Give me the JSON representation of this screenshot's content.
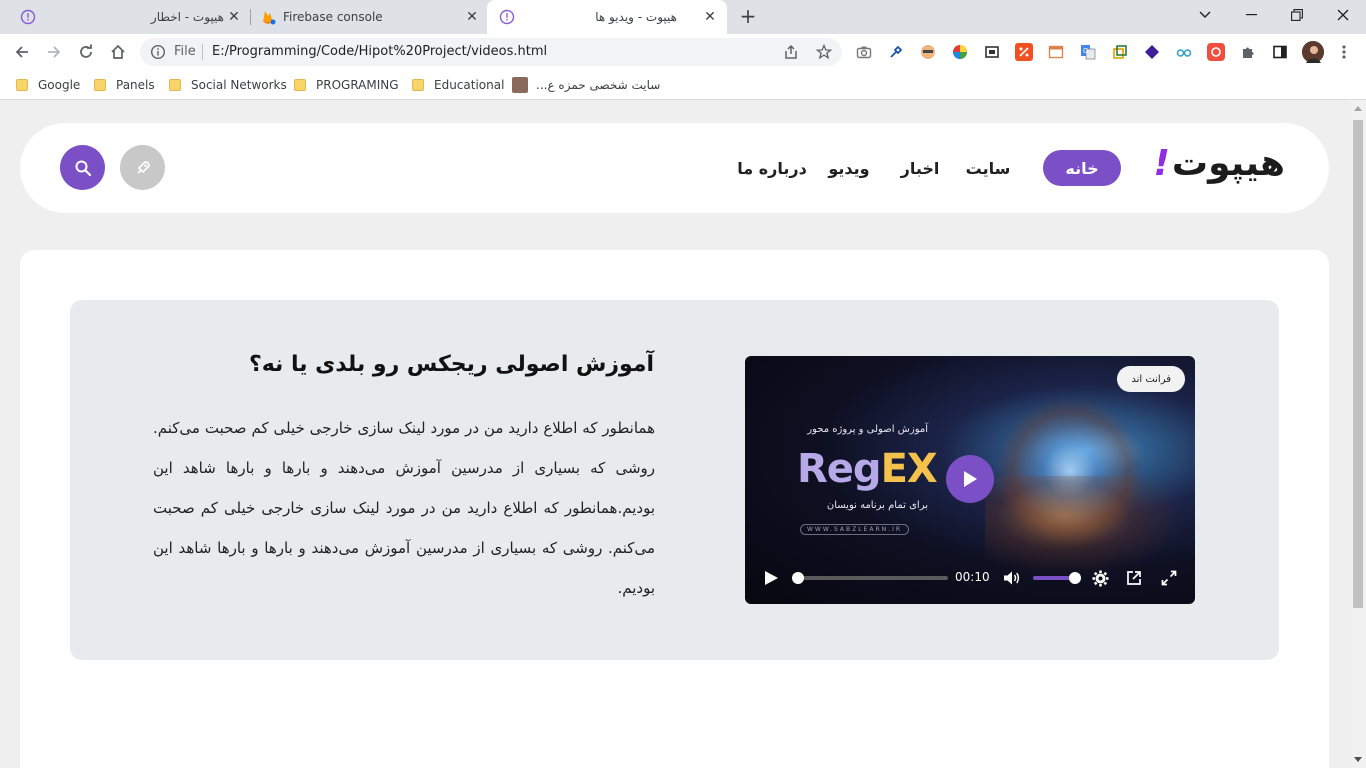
{
  "browser": {
    "tabs": [
      {
        "title": "هیپوت - اخطار"
      },
      {
        "title": "Firebase console"
      },
      {
        "title": "هیپوت - ویدیو ها"
      }
    ],
    "address": {
      "scheme": "File",
      "url": "E:/Programming/Code/Hipot%20Project/videos.html"
    },
    "bookmarks": [
      {
        "label": "Google"
      },
      {
        "label": "Panels"
      },
      {
        "label": "Social Networks"
      },
      {
        "label": "PROGRAMING"
      },
      {
        "label": "Educational"
      },
      {
        "label": "سایت شخصی حمزه ع..."
      }
    ]
  },
  "site": {
    "logo_text": "هیپوت",
    "logo_mark": "!",
    "nav": [
      {
        "label": "خانه"
      },
      {
        "label": "سایت"
      },
      {
        "label": "اخبار"
      },
      {
        "label": "ویدیو"
      },
      {
        "label": "درباره ما"
      }
    ],
    "accent": "#7b4fc6"
  },
  "article": {
    "title": "آموزش اصولی ریجکس رو بلدی یا نه؟",
    "body": "همانطور که اطلاع دارید من در مورد لینک سازی خارجی خیلی کم صحبت می‌کنم. روشی که بسیاری از مدرسین آموزش می‌دهند و بارها و بارها شاهد این بودیم.همانطور که اطلاع دارید من در مورد لینک سازی خارجی خیلی کم صحبت می‌کنم. روشی که بسیاری از مدرسین آموزش می‌دهند و بارها و بارها شاهد این بودیم."
  },
  "video": {
    "badge": "فرانت اند",
    "poster_subtitle": "آموزش اصولی و پروژه محور",
    "poster_title_a": "Reg",
    "poster_title_b": "EX",
    "poster_tagline": "برای تمام برنامه نویسان",
    "poster_url": "WWW.SABZLEARN.IR",
    "time": "00:10",
    "progress_fraction": 0.0,
    "volume_fraction": 1.0
  }
}
